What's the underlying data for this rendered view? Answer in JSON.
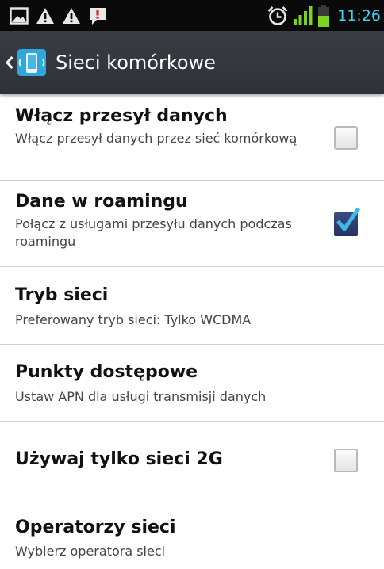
{
  "status_bar": {
    "left_icons": [
      "gallery-icon",
      "warning-icon",
      "warning-icon",
      "message-alert-icon"
    ],
    "right_icons": [
      "alarm-clock-icon",
      "signal-bars-icon",
      "battery-icon"
    ],
    "time": "11:26",
    "accent_color": "#3fd3f0"
  },
  "action_bar": {
    "back_icon": "chevron-left-icon",
    "app_icon": "mobile-network-icon",
    "title": "Sieci komórkowe"
  },
  "settings": [
    {
      "title": "Włącz przesył danych",
      "summary": "Włącz przesył danych przez sieć komórkową",
      "checkbox": true,
      "checked": false
    },
    {
      "title": "Dane w roamingu",
      "summary": "Połącz z usługami przesyłu danych podczas roamingu",
      "checkbox": true,
      "checked": true
    },
    {
      "title": "Tryb sieci",
      "summary": "Preferowany tryb sieci: Tylko WCDMA",
      "checkbox": false
    },
    {
      "title": "Punkty dostępowe",
      "summary": "Ustaw APN dla usługi transmisji danych",
      "checkbox": false
    },
    {
      "title": "Używaj tylko sieci 2G",
      "summary": "",
      "checkbox": true,
      "checked": false
    },
    {
      "title": "Operatorzy sieci",
      "summary": "Wybierz operatora sieci",
      "checkbox": false
    }
  ]
}
